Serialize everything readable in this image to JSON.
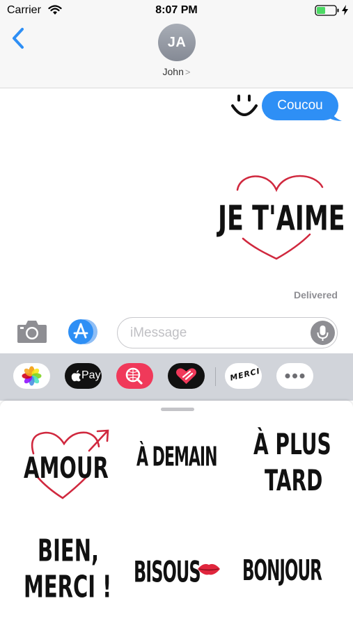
{
  "status_bar": {
    "carrier": "Carrier",
    "time": "8:07 PM",
    "icons": [
      "wifi-icon",
      "battery-icon",
      "charging-bolt-icon"
    ],
    "battery_color": "#4cd964"
  },
  "header": {
    "back_icon": "chevron-left-icon",
    "avatar_initials": "JA",
    "contact_name": "John",
    "contact_chevron": ">"
  },
  "conversation": {
    "messages": [
      {
        "type": "text",
        "text": "Coucou",
        "from": "me"
      },
      {
        "type": "sticker",
        "text": "JE T'AIME",
        "from": "me"
      }
    ],
    "smiley_icon": "smiley-sticker-icon",
    "status": "Delivered"
  },
  "input_bar": {
    "camera_icon": "camera-icon",
    "app_store_icon": "app-store-icon",
    "placeholder": "iMessage",
    "mic_icon": "microphone-icon"
  },
  "app_drawer": {
    "apps": [
      {
        "name": "photos-app-icon"
      },
      {
        "name": "apple-pay-app-icon",
        "label": "Pay"
      },
      {
        "name": "image-search-app-icon"
      },
      {
        "name": "digital-touch-app-icon"
      },
      {
        "name": "merci-stickers-app-icon",
        "label": "MERCI"
      },
      {
        "name": "more-apps-icon"
      }
    ]
  },
  "stickers": [
    {
      "text": "AMOUR"
    },
    {
      "text": "À DEMAIN"
    },
    {
      "line1": "À PLUS",
      "line2": "TARD"
    },
    {
      "line1": "BIEN,",
      "line2": "MERCI !"
    },
    {
      "text": "BISOUS"
    },
    {
      "text": "BONJOUR"
    }
  ],
  "colors": {
    "accent": "#2e8ff5",
    "heart_red": "#d0283e"
  }
}
